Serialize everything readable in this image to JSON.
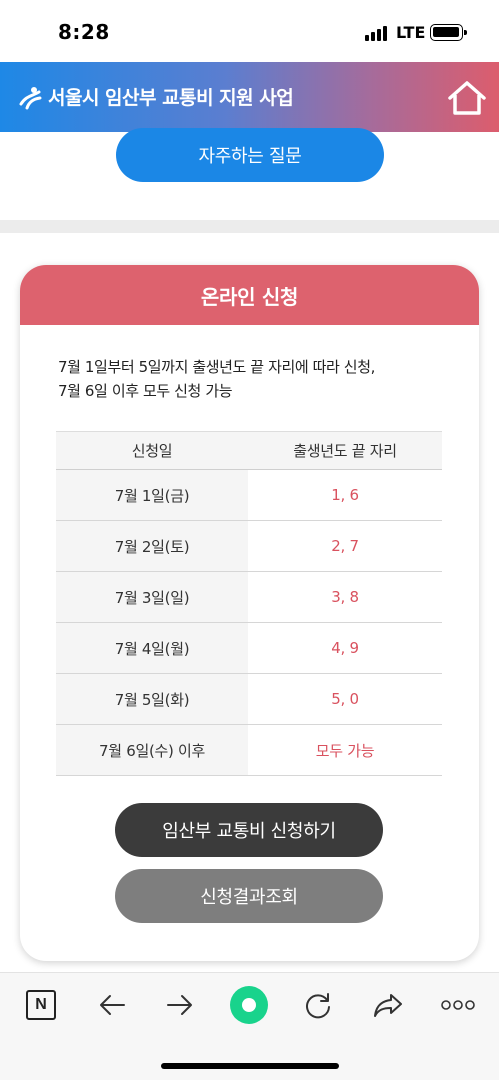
{
  "status_bar": {
    "time": "8:28",
    "network": "LTE"
  },
  "header": {
    "title": "서울시 임산부 교통비 지원 사업",
    "logo_icon": "seoul-logo-icon",
    "home_icon": "home-icon"
  },
  "faq_button": {
    "label": "자주하는 질문"
  },
  "card": {
    "title": "온라인 신청",
    "description_line1": "7월 1일부터 5일까지 출생년도 끝 자리에 따라 신청,",
    "description_line2": "7월 6일 이후 모두 신청 가능",
    "table": {
      "headers": [
        "신청일",
        "출생년도 끝 자리"
      ],
      "rows": [
        {
          "date": "7월 1일(금)",
          "digits": "1, 6"
        },
        {
          "date": "7월 2일(토)",
          "digits": "2, 7"
        },
        {
          "date": "7월 3일(일)",
          "digits": "3, 8"
        },
        {
          "date": "7월 4일(월)",
          "digits": "4, 9"
        },
        {
          "date": "7월 5일(화)",
          "digits": "5, 0"
        },
        {
          "date": "7월 6일(수) 이후",
          "digits": "모두 가능"
        }
      ]
    },
    "apply_button": "임산부 교통비 신청하기",
    "result_button": "신청결과조회"
  },
  "toolbar": {
    "items": [
      "naver-n-icon",
      "back-arrow-icon",
      "forward-arrow-icon",
      "green-dot-icon",
      "refresh-icon",
      "share-icon",
      "more-icon"
    ],
    "n_label": "N"
  },
  "colors": {
    "blue": "#1b87e6",
    "pink": "#dd626e",
    "accent_text": "#d9525f",
    "dark_button": "#3b3b3b",
    "gray_button": "#7e7e7e",
    "green": "#19d38c"
  }
}
